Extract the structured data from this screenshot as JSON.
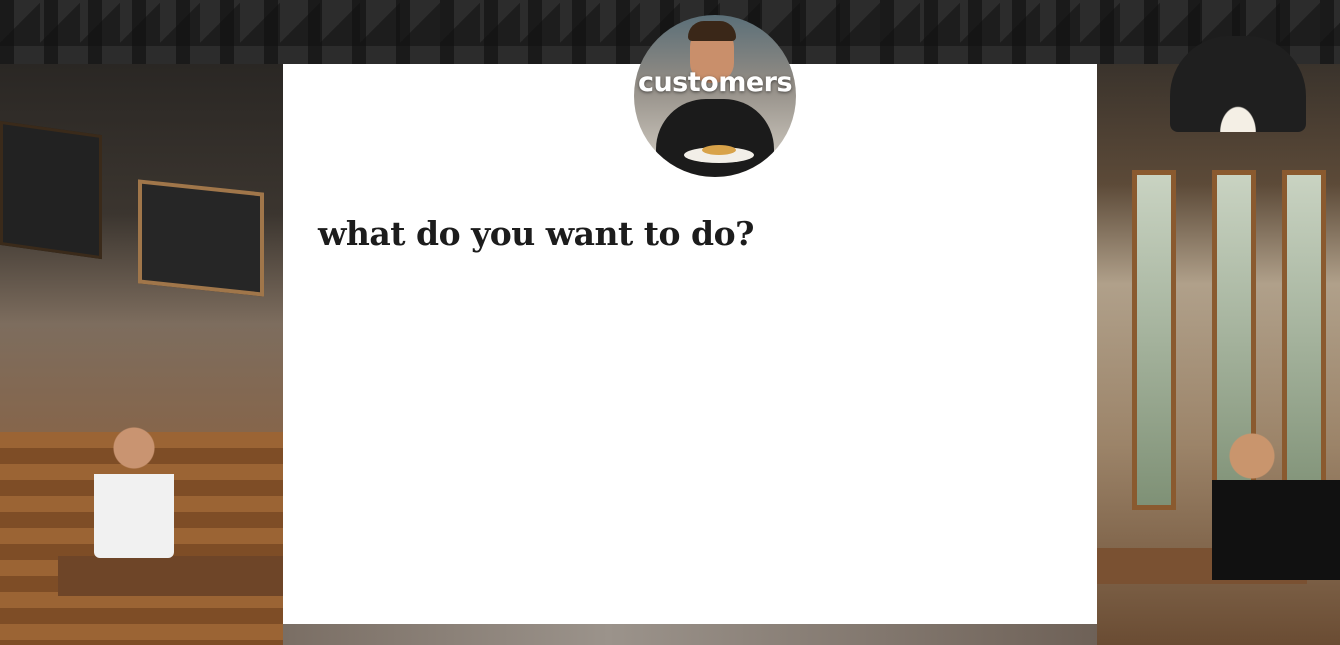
{
  "header": {
    "avatar_label": "customers"
  },
  "main": {
    "heading": "what do you want to do?"
  },
  "colors": {
    "card_background": "#ffffff",
    "heading_text": "#1c1c1c",
    "avatar_label_text": "#ffffff"
  }
}
